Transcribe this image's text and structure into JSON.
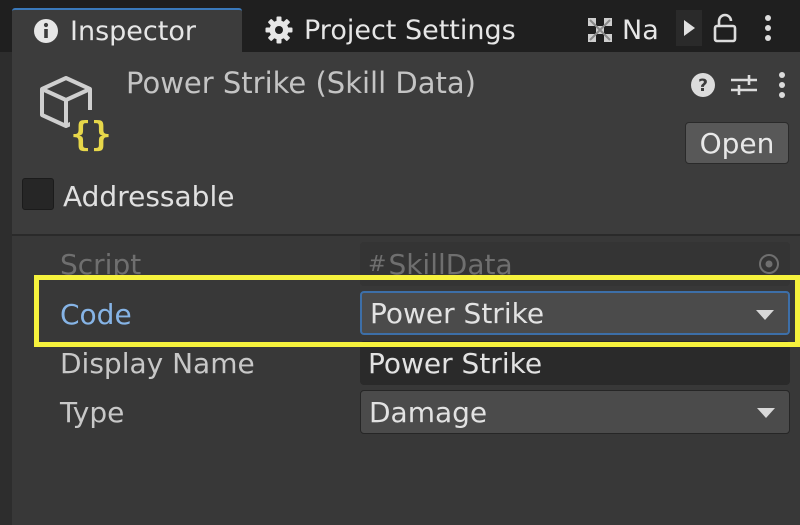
{
  "tabs": [
    {
      "label": "Inspector",
      "icon": "info-icon",
      "active": true
    },
    {
      "label": "Project Settings",
      "icon": "gear-icon",
      "active": false
    },
    {
      "label": "Na",
      "icon": "navigation-icon",
      "active": false
    }
  ],
  "tabbar_icons": [
    "triangle-right-icon",
    "lock-icon",
    "kebab-menu-icon"
  ],
  "header": {
    "title": "Power Strike (Skill Data)",
    "asset_icon": "scriptable-object-icon",
    "icons": [
      "help-icon",
      "preset-icon",
      "kebab-menu-icon"
    ],
    "open_label": "Open",
    "addressable_label": "Addressable",
    "addressable_checked": false
  },
  "properties": {
    "script": {
      "label": "Script",
      "value": "SkillData",
      "icon": "hash-icon",
      "disabled": true
    },
    "code": {
      "label": "Code",
      "value": "Power Strike",
      "kind": "dropdown",
      "focused": true
    },
    "display_name": {
      "label": "Display Name",
      "value": "Power Strike",
      "kind": "text"
    },
    "type": {
      "label": "Type",
      "value": "Damage",
      "kind": "dropdown"
    }
  },
  "colors": {
    "background": "#383838",
    "tabbar": "#1f1f1f",
    "focus_blue": "#3d6fa8",
    "highlight_yellow": "#f6f23d",
    "scriptable_icon_yellow": "#e7d74a"
  }
}
